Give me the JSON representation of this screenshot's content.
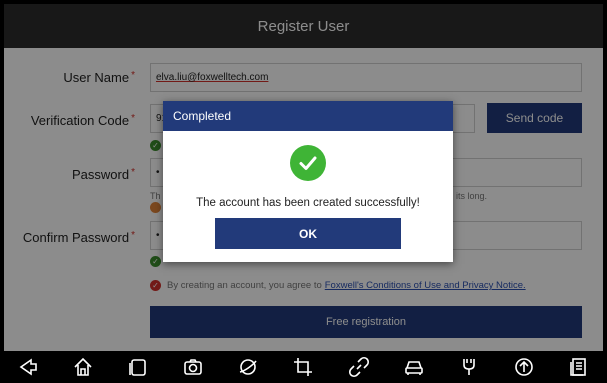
{
  "window": {
    "title": "Register User"
  },
  "form": {
    "username": {
      "label": "User Name",
      "required_mark": "*",
      "value": "elva.liu@foxwelltech.com"
    },
    "verification": {
      "label": "Verification Code",
      "required_mark": "*",
      "value_visible": "91",
      "send_button": "Send code"
    },
    "password": {
      "label": "Password",
      "required_mark": "*",
      "value_visible": "•",
      "hint_start": "Th",
      "hint_end": "its long."
    },
    "confirm": {
      "label": "Confirm Password",
      "required_mark": "*",
      "value_visible": "•"
    },
    "agreement": {
      "text": "By creating an account, you agree to",
      "link": "Foxwell's Conditions of Use and Privacy Notice."
    },
    "submit_button": "Free registration"
  },
  "dialog": {
    "title": "Completed",
    "message": "The account has been created successfully!",
    "ok_button": "OK"
  },
  "navbar": {
    "icons": [
      "back-icon",
      "home-icon",
      "recent-apps-icon",
      "camera-icon",
      "browser-icon",
      "crop-icon",
      "link-icon",
      "car-icon",
      "vci-icon",
      "upload-icon",
      "report-icon"
    ]
  },
  "colors": {
    "primary": "#223a7a",
    "success": "#3fb436",
    "required": "#d0302a",
    "titlebar": "#2c2c2c"
  }
}
